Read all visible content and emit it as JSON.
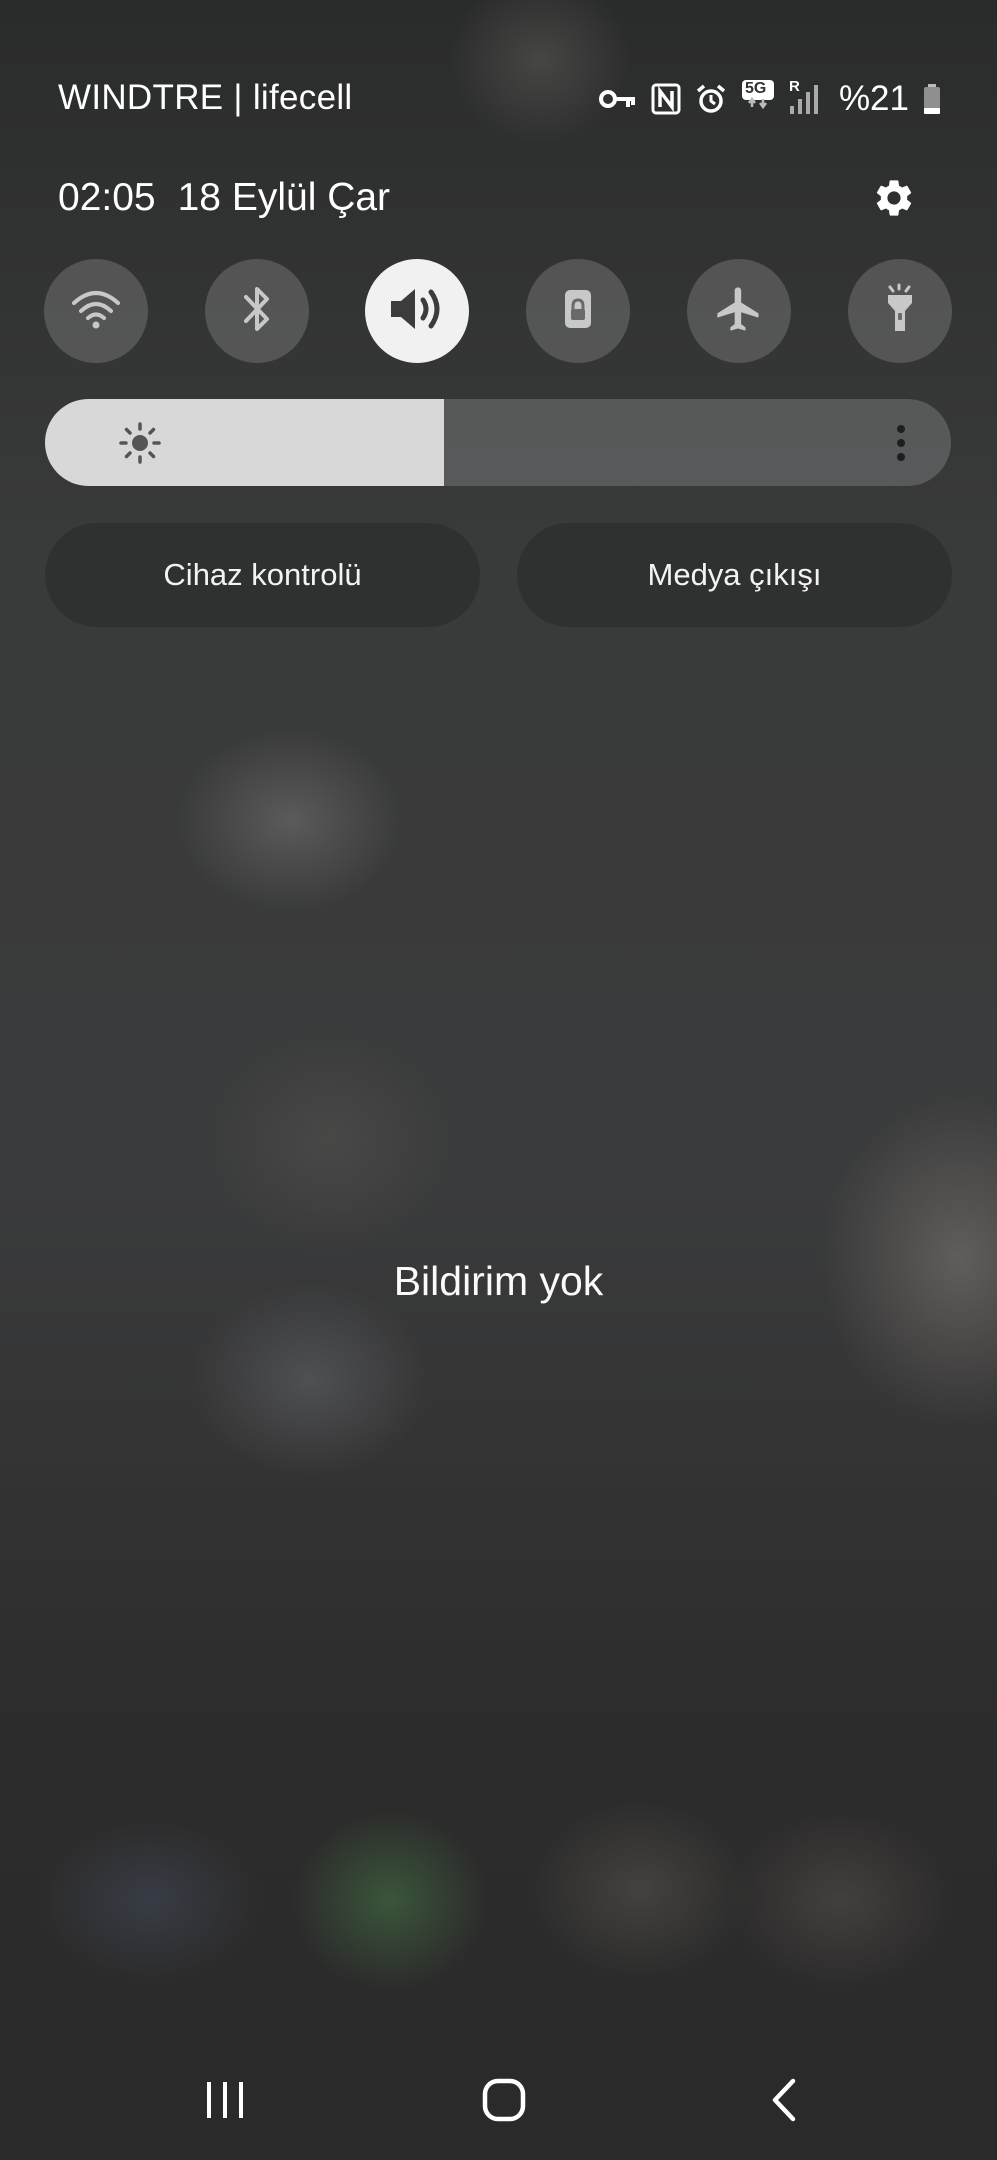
{
  "status_bar": {
    "carrier": "WINDTRE | lifecell",
    "icons": [
      "vpn-key-icon",
      "nfc-icon",
      "alarm-icon",
      "5g-icon",
      "signal-icon",
      "battery-icon"
    ],
    "network_type": "5G",
    "roaming": "R",
    "battery_text": "%21",
    "battery_level_percent": 21
  },
  "header": {
    "time": "02:05",
    "date": "18 Eylül Çar",
    "settings_icon": "gear-icon"
  },
  "quick_toggles": [
    {
      "id": "wifi",
      "icon": "wifi-icon",
      "active": false
    },
    {
      "id": "bluetooth",
      "icon": "bluetooth-icon",
      "active": false
    },
    {
      "id": "sound",
      "icon": "volume-icon",
      "active": true
    },
    {
      "id": "rotation-lock",
      "icon": "lock-icon",
      "active": false
    },
    {
      "id": "airplane",
      "icon": "airplane-icon",
      "active": false
    },
    {
      "id": "flashlight",
      "icon": "flashlight-icon",
      "active": false
    }
  ],
  "brightness": {
    "level_fraction": 0.44,
    "icon": "sun-icon",
    "more_icon": "more-vert-icon"
  },
  "buttons": {
    "device_control": "Cihaz kontrolü",
    "media_output": "Medya çıkışı"
  },
  "notifications": {
    "empty_text": "Bildirim yok"
  },
  "nav_bar": {
    "recents_icon": "recents-icon",
    "home_icon": "home-icon",
    "back_icon": "back-icon"
  },
  "colors": {
    "toggle_active": "#f1f1f1",
    "toggle_inactive": "#7a7a7a",
    "brightness_fill": "#d8d8d8"
  }
}
